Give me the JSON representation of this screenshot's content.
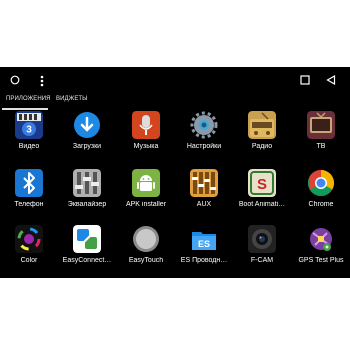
{
  "tabs": {
    "apps": "ПРИЛОЖЕНИЯ",
    "widgets": "ВИДЖЕТЫ"
  },
  "apps": [
    {
      "label": "Видео"
    },
    {
      "label": "Загрузки"
    },
    {
      "label": "Музыка"
    },
    {
      "label": "Настройки"
    },
    {
      "label": "Радио"
    },
    {
      "label": "ТВ"
    },
    {
      "label": "Телефон"
    },
    {
      "label": "Эквалайзер"
    },
    {
      "label": "APK installer"
    },
    {
      "label": "AUX"
    },
    {
      "label": "Boot Animati…"
    },
    {
      "label": "Chrome"
    },
    {
      "label": "Color"
    },
    {
      "label": "EasyConnect…"
    },
    {
      "label": "EasyTouch"
    },
    {
      "label": "ES Проводн…"
    },
    {
      "label": "F-CAM"
    },
    {
      "label": "GPS Test Plus"
    }
  ]
}
